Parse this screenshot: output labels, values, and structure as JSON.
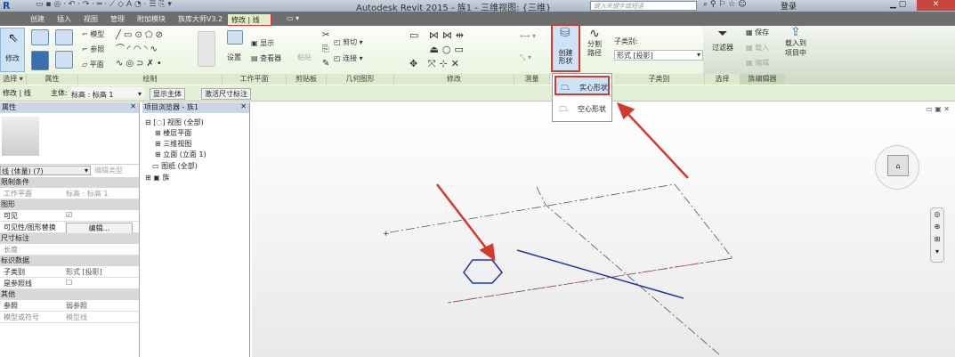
{
  "title": "Autodesk Revit 2015 -    族1 - 三维视图: {三维}",
  "search_placeholder": "键入关键字或短语",
  "login": "登录",
  "tabs": [
    "创建",
    "插入",
    "视图",
    "管理",
    "附加模块",
    "族库大师V3.2",
    "修改 | 线"
  ],
  "ribbon": {
    "modify": "修改",
    "model": "模型",
    "reference": "参照",
    "plane": "平面",
    "set": "设置",
    "show": "显示",
    "viewer": "查看器",
    "paste": "粘贴",
    "cut": "剪切",
    "join": "连接",
    "create_form": [
      "创建",
      "形状"
    ],
    "split_path": [
      "分割",
      "路径"
    ],
    "subcategory_label": "子类别:",
    "subcategory_value": "形式 [投影]",
    "filter": "过滤器",
    "save": "保存",
    "load": "载入",
    "edit": "编辑",
    "load_into_project": [
      "载入到",
      "项目中"
    ],
    "panels": [
      "选择 ▾",
      "属性",
      "绘制",
      "工作平面",
      "剪贴板",
      "几何图形",
      "修改",
      "测量",
      "子类别",
      "选择",
      "族编辑器"
    ]
  },
  "dropdown": {
    "solid": "实心形状",
    "void": "空心形状"
  },
  "options_bar": {
    "context": "修改 | 线",
    "host_label": "主体:",
    "host_value": "标高 : 标高 1",
    "show_host": "显示主体",
    "activate_dim": "激活尺寸标注"
  },
  "properties": {
    "title": "属性",
    "type": "线 (体量) (7)",
    "edit_type": "编辑类型",
    "groups": [
      {
        "name": "限制条件",
        "rows": [
          [
            "工作平面",
            "标高 : 标高 1"
          ]
        ]
      },
      {
        "name": "图形",
        "rows": [
          [
            "可见",
            "☑"
          ],
          [
            "可见性/图形替换",
            "编辑..."
          ]
        ]
      },
      {
        "name": "尺寸标注",
        "rows": [
          [
            "长度",
            ""
          ]
        ]
      },
      {
        "name": "标识数据",
        "rows": [
          [
            "子类别",
            "形式 [投影]"
          ],
          [
            "是参照线",
            "☐"
          ]
        ]
      },
      {
        "name": "其他",
        "rows": [
          [
            "参照",
            "弱参照"
          ],
          [
            "模型或符号",
            "模型线"
          ]
        ]
      }
    ]
  },
  "browser": {
    "title": "项目浏览器 - 族1",
    "items": [
      "视图 (全部)",
      "楼层平面",
      "三维视图",
      "立面 (立面 1)",
      "图纸 (全部)",
      "族"
    ]
  },
  "colors": {
    "accent_red": "#d33a2c",
    "line_blue": "#2233aa"
  }
}
